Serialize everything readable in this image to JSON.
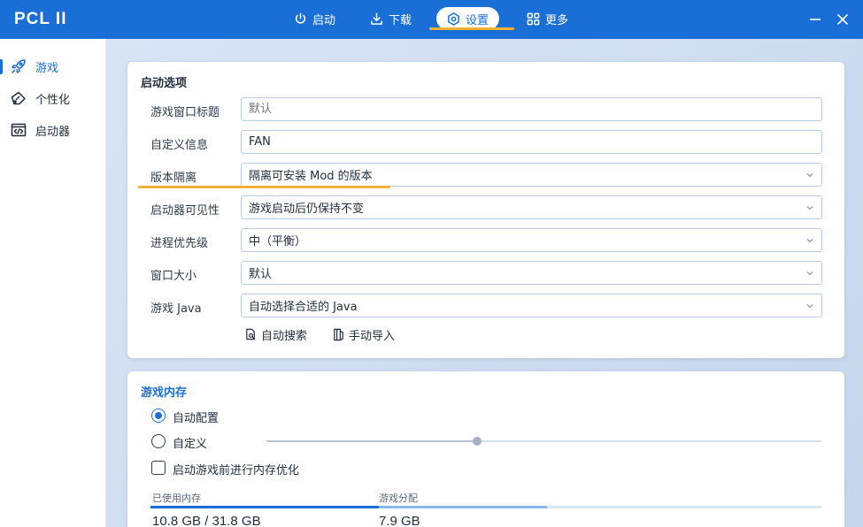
{
  "app": {
    "title": "PCL II"
  },
  "nav": {
    "items": [
      {
        "label": "启动",
        "icon": "power-icon"
      },
      {
        "label": "下载",
        "icon": "download-icon"
      },
      {
        "label": "设置",
        "icon": "settings-icon",
        "active": true
      },
      {
        "label": "更多",
        "icon": "grid-icon"
      }
    ]
  },
  "sidebar": {
    "items": [
      {
        "label": "游戏",
        "icon": "rocket-icon",
        "active": true
      },
      {
        "label": "个性化",
        "icon": "palette-icon"
      },
      {
        "label": "启动器",
        "icon": "code-window-icon"
      }
    ]
  },
  "launch_options": {
    "title": "启动选项",
    "rows": [
      {
        "label": "游戏窗口标题",
        "value": "",
        "placeholder": "默认",
        "type": "text"
      },
      {
        "label": "自定义信息",
        "value": "FAN",
        "type": "text"
      },
      {
        "label": "版本隔离",
        "value": "隔离可安装 Mod 的版本",
        "type": "select"
      },
      {
        "label": "启动器可见性",
        "value": "游戏启动后仍保持不变",
        "type": "select"
      },
      {
        "label": "进程优先级",
        "value": "中（平衡）",
        "type": "select"
      },
      {
        "label": "窗口大小",
        "value": "默认",
        "type": "select"
      },
      {
        "label": "游戏 Java",
        "value": "自动选择合适的 Java",
        "type": "select"
      }
    ],
    "auto_search_label": "自动搜索",
    "manual_import_label": "手动导入"
  },
  "memory": {
    "title": "游戏内存",
    "auto_label": "自动配置",
    "custom_label": "自定义",
    "optimize_label": "启动游戏前进行内存优化",
    "used_label": "已使用内存",
    "used_value": "10.8 GB / 31.8 GB",
    "alloc_label": "游戏分配",
    "alloc_value": "7.9 GB",
    "used_fraction": 0.34,
    "alloc_fraction": 0.25,
    "slider_fraction": 0.38
  },
  "colors": {
    "accent": "#1a6fd6",
    "highlight": "#f2b233",
    "alloc_bar": "#8ab8ee",
    "free_bar": "#dbe8f7"
  }
}
